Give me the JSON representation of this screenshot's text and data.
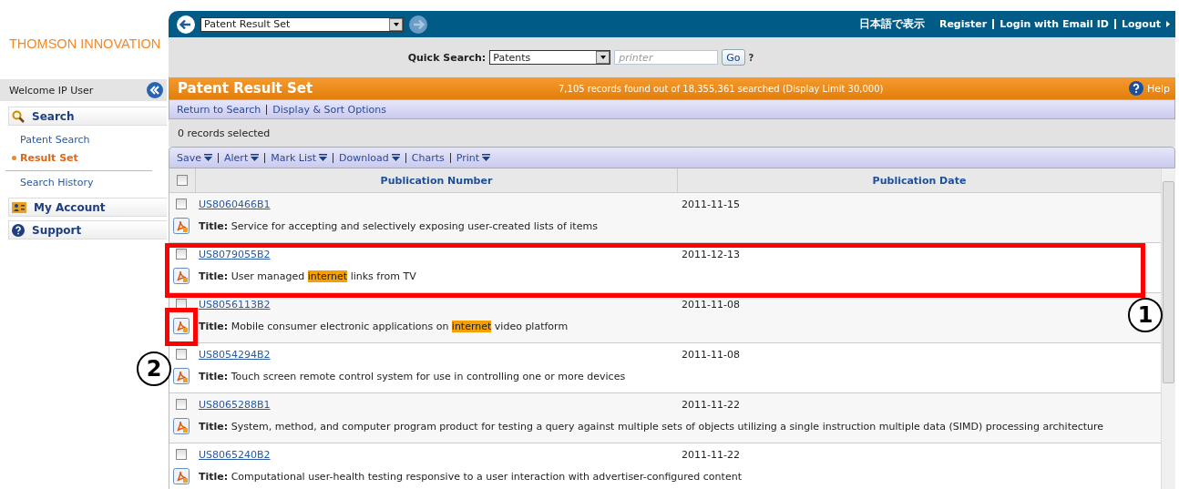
{
  "brand": {
    "logo": "THOMSON INNOVATION"
  },
  "nav": {
    "history_select": "Patent Result Set",
    "language_link": "日本語で表示",
    "links": [
      "Register",
      "Login with Email ID",
      "Logout"
    ]
  },
  "quick_search": {
    "label": "Quick Search:",
    "collection": "Patents",
    "placeholder": "printer",
    "go": "Go",
    "help": "?"
  },
  "sidebar": {
    "welcome": "Welcome IP User",
    "sections": [
      {
        "kind": "search",
        "label": "Search",
        "items": [
          {
            "label": "Patent Search",
            "selected": false
          },
          {
            "label": "Result Set",
            "selected": true
          },
          {
            "label": "Search History",
            "selected": false
          }
        ]
      },
      {
        "kind": "account",
        "label": "My Account"
      },
      {
        "kind": "support",
        "label": "Support"
      }
    ]
  },
  "header": {
    "title": "Patent Result Set",
    "summary": "7,105 records found out of 18,355,361 searched (Display Limit 30,000)",
    "help": "Help"
  },
  "sublinks": [
    "Return to Search",
    "Display & Sort Options"
  ],
  "selection_count": "0 records selected",
  "toolbar": [
    {
      "label": "Save",
      "menu": true
    },
    {
      "label": "Alert",
      "menu": true
    },
    {
      "label": "Mark List",
      "menu": true
    },
    {
      "label": "Download",
      "menu": true
    },
    {
      "label": "Charts",
      "menu": false
    },
    {
      "label": "Print",
      "menu": true
    }
  ],
  "table": {
    "select_all_checked": false,
    "columns": [
      "Publication Number",
      "Publication Date"
    ],
    "rows": [
      {
        "number": "US8060466B1",
        "date": "2011-11-15",
        "checked": false,
        "label": "Title:",
        "title": [
          {
            "text": "Service for accepting and selectively exposing user-created lists of items",
            "highlight": false
          }
        ]
      },
      {
        "number": "US8079055B2",
        "date": "2011-12-13",
        "checked": false,
        "label": "Title:",
        "title": [
          {
            "text": "User managed ",
            "highlight": false
          },
          {
            "text": "internet",
            "highlight": true
          },
          {
            "text": " links from TV",
            "highlight": false
          }
        ]
      },
      {
        "number": "US8056113B2",
        "date": "2011-11-08",
        "checked": false,
        "label": "Title:",
        "title": [
          {
            "text": "Mobile consumer electronic applications on ",
            "highlight": false
          },
          {
            "text": "internet",
            "highlight": true
          },
          {
            "text": " video platform",
            "highlight": false
          }
        ]
      },
      {
        "number": "US8054294B2",
        "date": "2011-11-08",
        "checked": false,
        "label": "Title:",
        "title": [
          {
            "text": "Touch screen remote control system for use in controlling one or more devices",
            "highlight": false
          }
        ]
      },
      {
        "number": "US8065288B1",
        "date": "2011-11-22",
        "checked": false,
        "label": "Title:",
        "title": [
          {
            "text": "System, method, and computer program product for testing a query against multiple sets of objects utilizing a single instruction multiple data (SIMD) processing architecture",
            "highlight": false
          }
        ]
      },
      {
        "number": "US8065240B2",
        "date": "2011-11-22",
        "checked": false,
        "label": "Title:",
        "title": [
          {
            "text": "Computational user-health testing responsive to a user interaction with advertiser-configured content",
            "highlight": false
          }
        ]
      }
    ]
  },
  "callouts": [
    {
      "number": "1",
      "kind": "row-frame"
    },
    {
      "number": "2",
      "kind": "icon-frame"
    }
  ]
}
